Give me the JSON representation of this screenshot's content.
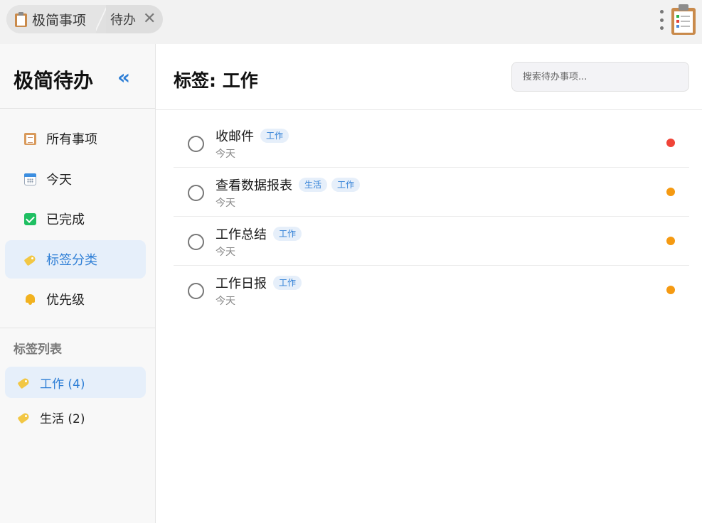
{
  "topbar": {
    "app_tab_label": "极简事项",
    "page_tab_label": "待办",
    "close_glyph": "✕"
  },
  "sidebar": {
    "brand": "极简待办",
    "collapse_glyph": "«",
    "nav": [
      {
        "label": "所有事项",
        "icon": "clipboard-icon"
      },
      {
        "label": "今天",
        "icon": "calendar-icon"
      },
      {
        "label": "已完成",
        "icon": "checkbox-icon"
      },
      {
        "label": "标签分类",
        "icon": "tag-icon",
        "active": true
      },
      {
        "label": "优先级",
        "icon": "bell-icon"
      }
    ],
    "tags_section_title": "标签列表",
    "tags": [
      {
        "label": "工作 (4)",
        "active": true
      },
      {
        "label": "生活 (2)"
      }
    ]
  },
  "main": {
    "title": "标签: 工作",
    "search_placeholder": "搜索待办事项...",
    "tasks": [
      {
        "title": "收邮件",
        "tags": [
          "工作"
        ],
        "date": "今天",
        "priority": "high",
        "priority_color": "#f04438"
      },
      {
        "title": "查看数据报表",
        "tags": [
          "生活",
          "工作"
        ],
        "date": "今天",
        "priority": "medium",
        "priority_color": "#f59a12"
      },
      {
        "title": "工作总结",
        "tags": [
          "工作"
        ],
        "date": "今天",
        "priority": "medium",
        "priority_color": "#f59a12"
      },
      {
        "title": "工作日报",
        "tags": [
          "工作"
        ],
        "date": "今天",
        "priority": "medium",
        "priority_color": "#f59a12"
      }
    ]
  },
  "colors": {
    "accent": "#2f7fd6",
    "active_bg": "#e6effa"
  }
}
